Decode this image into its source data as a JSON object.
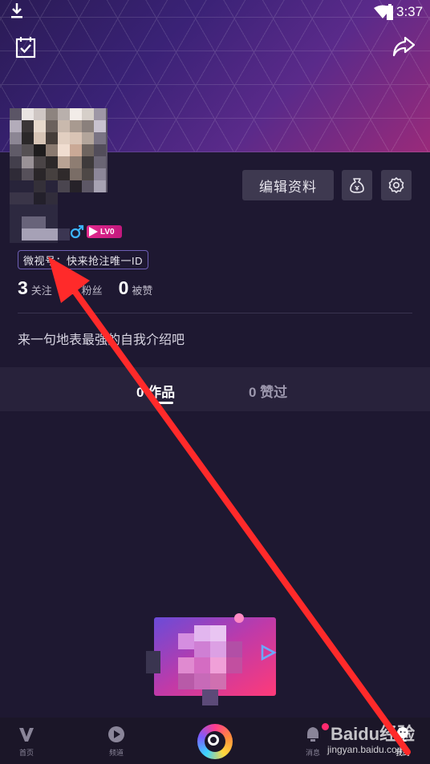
{
  "status_bar": {
    "time": "3:37"
  },
  "profile": {
    "edit_button": "编辑资料",
    "level": "LV0",
    "weishi_id": "微视号：快来抢注唯一ID",
    "stats": [
      {
        "value": "3",
        "label": "关注"
      },
      {
        "value": "0",
        "label": "粉丝"
      },
      {
        "value": "0",
        "label": "被赞"
      }
    ],
    "bio": "来一句地表最强的自我介绍吧"
  },
  "tabs": {
    "works": "0 作品",
    "liked": "0 赞过"
  },
  "bottom_nav": {
    "home": "首页",
    "channel": "频道",
    "message": "消息",
    "me": "我的"
  },
  "watermark": {
    "brand": "Baidu经验",
    "url": "jingyan.baidu.com"
  },
  "colors": {
    "accent_pink": "#e42a8e",
    "arrow_red": "#ff2a2a",
    "background": "#1e1831"
  }
}
